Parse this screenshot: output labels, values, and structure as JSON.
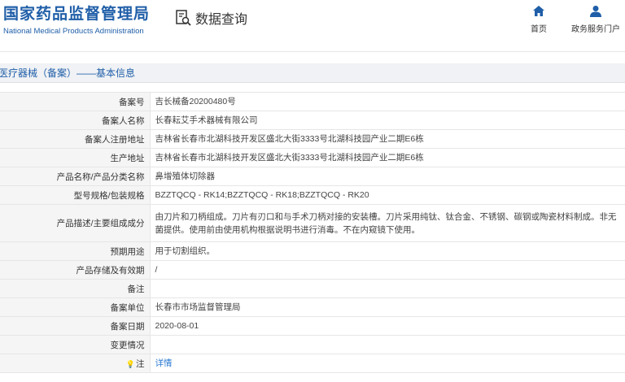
{
  "header": {
    "logo_cn": "国家药品监督管理局",
    "logo_en": "National Medical Products Administration",
    "query_label": "数据查询",
    "nav": [
      {
        "label": "首页",
        "icon": "home-icon"
      },
      {
        "label": "政务服务门户",
        "icon": "user-icon"
      }
    ]
  },
  "section": {
    "title": "医疗器械（备案）——基本信息"
  },
  "rows": [
    {
      "label": "备案号",
      "value": "吉长械备20200480号"
    },
    {
      "label": "备案人名称",
      "value": "长春耘艾手术器械有限公司"
    },
    {
      "label": "备案人注册地址",
      "value": "吉林省长春市北湖科技开发区盛北大街3333号北湖科技园产业二期E6栋"
    },
    {
      "label": "生产地址",
      "value": "吉林省长春市北湖科技开发区盛北大街3333号北湖科技园产业二期E6栋"
    },
    {
      "label": "产品名称/产品分类名称",
      "value": "鼻增殖体切除器"
    },
    {
      "label": "型号规格/包装规格",
      "value": "BZZTQCQ - RK14;BZZTQCQ - RK18;BZZTQCQ - RK20"
    },
    {
      "label": "产品描述/主要组成成分",
      "value": "由刀片和刀柄组成。刀片有刃口和与手术刀柄对接的安装槽。刀片采用纯钛、钛合金、不锈钢、碳钢或陶瓷材料制成。非无菌提供。使用前由使用机构根据说明书进行消毒。不在内窥镜下使用。"
    },
    {
      "label": "预期用途",
      "value": "用于切割组织。"
    },
    {
      "label": "产品存储及有效期",
      "value": "/"
    },
    {
      "label": "备注",
      "value": ""
    },
    {
      "label": "备案单位",
      "value": "长春市市场监督管理局"
    },
    {
      "label": "备案日期",
      "value": "2020-08-01"
    },
    {
      "label": "变更情况",
      "value": ""
    },
    {
      "label": "注",
      "value": "详情",
      "icon": "lightbulb-icon"
    }
  ],
  "colors": {
    "brand": "#1f5ea8",
    "link": "#2a7ad2",
    "label_bg": "#f5f5f5",
    "section_bg": "#f0f2f5"
  }
}
